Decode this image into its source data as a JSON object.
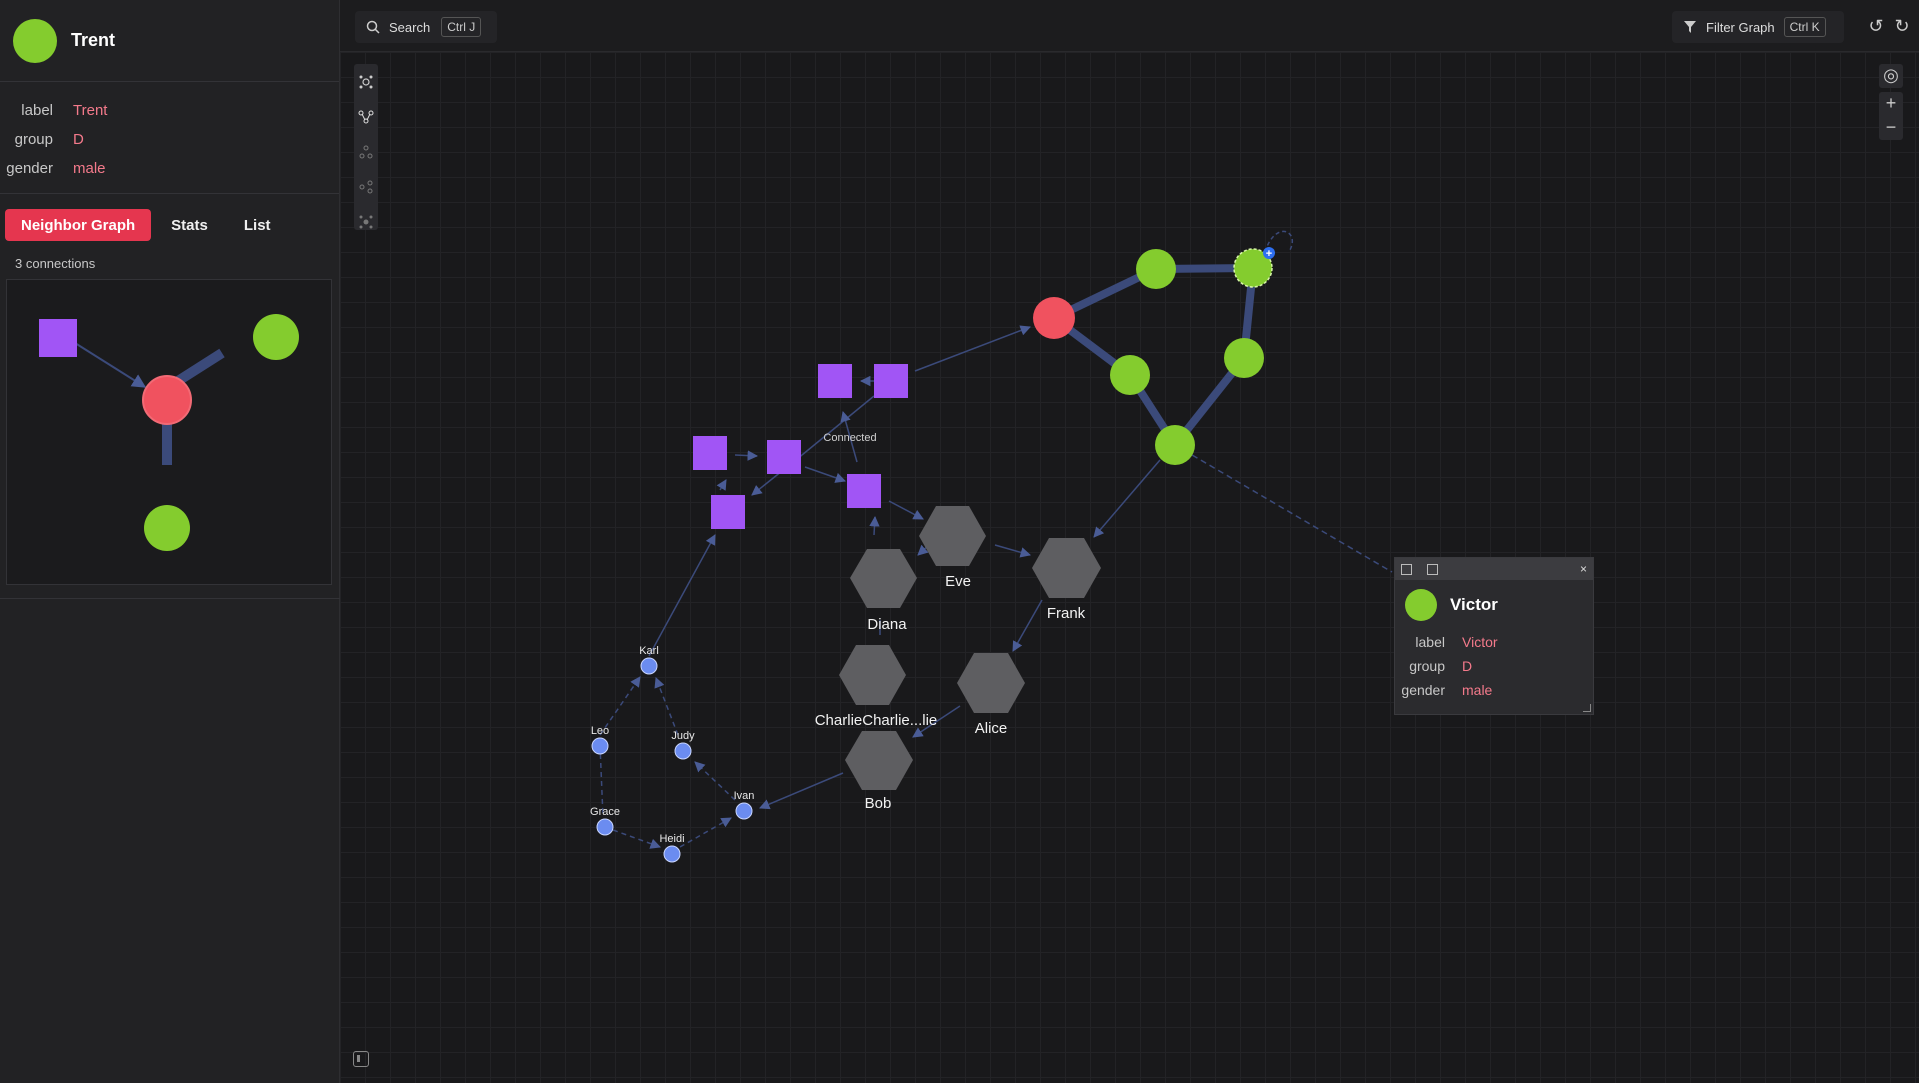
{
  "selected": {
    "name": "Trent",
    "props": [
      {
        "key": "label",
        "value": "Trent"
      },
      {
        "key": "group",
        "value": "D"
      },
      {
        "key": "gender",
        "value": "male"
      }
    ]
  },
  "tabs": [
    {
      "label": "Neighbor Graph",
      "active": true
    },
    {
      "label": "Stats",
      "active": false
    },
    {
      "label": "List",
      "active": false
    }
  ],
  "connections_text": "3 connections",
  "search": {
    "label": "Search",
    "shortcut": "Ctrl J"
  },
  "filter": {
    "label": "Filter Graph",
    "shortcut": "Ctrl K"
  },
  "colors": {
    "green": "#84cc2e",
    "red": "#f0525f",
    "purple": "#a155f5",
    "gray": "#5e5e61",
    "blue": "#6b8cf0",
    "edge": "#3b4a7a",
    "accent": "#e5364f",
    "value": "#f47a8b"
  },
  "graph": {
    "edge_label": "Connected",
    "hex_labels": {
      "eve": "Eve",
      "frank": "Frank",
      "diana": "Diana",
      "charlie": "CharlieCharlie...lie",
      "alice": "Alice",
      "bob": "Bob"
    },
    "small_labels": {
      "karl": "Karl",
      "leo": "Leo",
      "judy": "Judy",
      "grace": "Grace",
      "ivan": "Ivan",
      "heidi": "Heidi"
    }
  },
  "popup": {
    "name": "Victor",
    "props": [
      {
        "key": "label",
        "value": "Victor"
      },
      {
        "key": "group",
        "value": "D"
      },
      {
        "key": "gender",
        "value": "male"
      }
    ],
    "close": "×"
  },
  "toolbar": {
    "undo": "↺",
    "redo": "↻",
    "zoom_in": "+",
    "zoom_out": "−"
  }
}
